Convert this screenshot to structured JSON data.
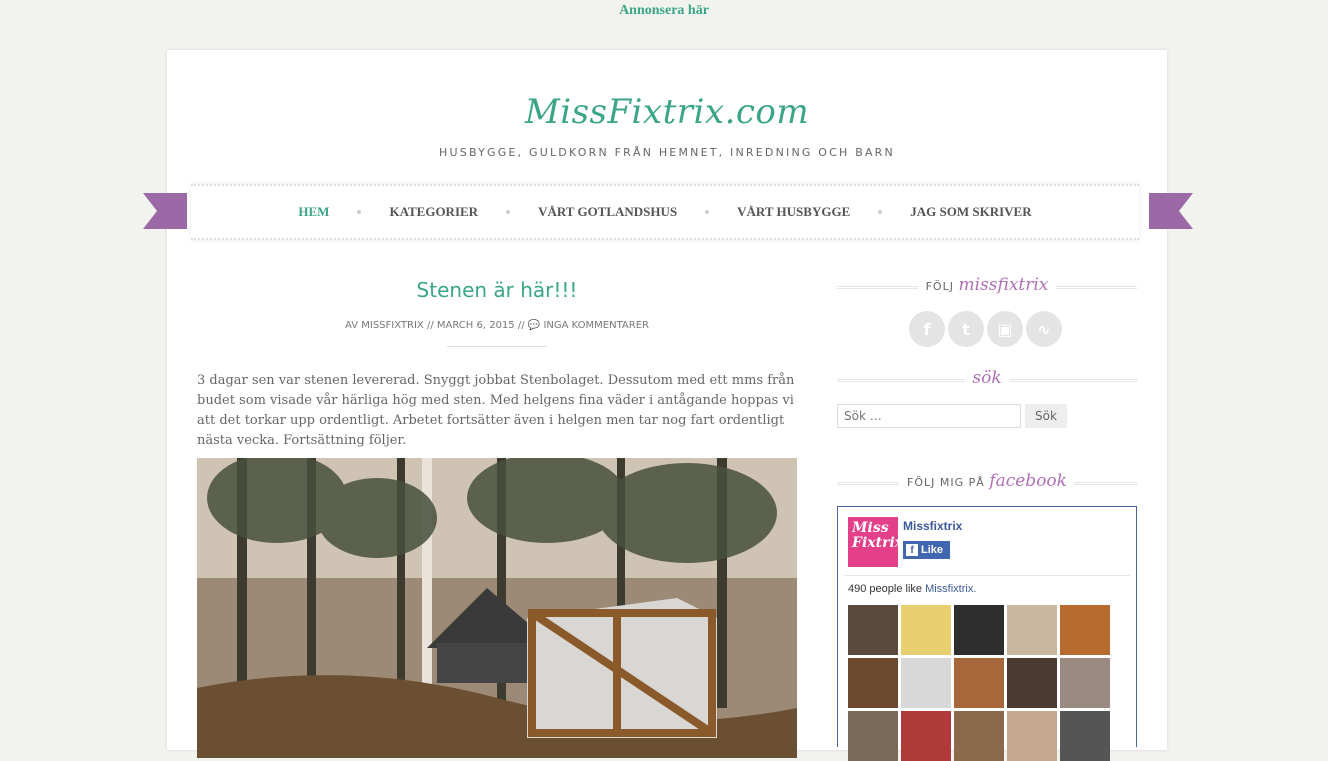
{
  "topbar": {
    "link": "Annonsera här"
  },
  "header": {
    "logo": "MissFixtrix.com",
    "tagline": "HUSBYGGE, GULDKORN FRÅN HEMNET, INREDNING OCH BARN"
  },
  "nav": {
    "items": [
      {
        "label": "HEM"
      },
      {
        "label": "KATEGORIER"
      },
      {
        "label": "VÅRT GOTLANDSHUS"
      },
      {
        "label": "VÅRT HUSBYGGE"
      },
      {
        "label": "JAG SOM SKRIVER"
      }
    ]
  },
  "post": {
    "title": "Stenen är här!!!",
    "meta": {
      "prefix": "AV",
      "author": "MISSFIXTRIX",
      "sep": "//",
      "date": "MARCH 6, 2015",
      "comments": "INGA KOMMENTARER"
    },
    "body": "3 dagar sen var stenen levererad. Snyggt jobbat Stenbolaget. Dessutom med ett mms från budet som visade vår härliga hög med sten. Med helgens fina väder i antågande hoppas vi att det torkar upp ordentligt. Arbetet fortsätter även i helgen men tar nog fart ordentligt nästa vecka. Fortsättning följer."
  },
  "sidebar": {
    "follow": {
      "label": "FÖLJ",
      "script": "missfixtrix",
      "icons": [
        "facebook-icon",
        "twitter-icon",
        "instagram-icon",
        "rss-icon"
      ]
    },
    "search": {
      "title": "sök",
      "placeholder": "Sök …",
      "button": "Sök"
    },
    "facebook": {
      "label": "FÖLJ MIG PÅ",
      "script": "facebook",
      "page_name": "Missfixtrix",
      "like": "Like",
      "count_text": "490 people like",
      "count_link": "Missfixtrix.",
      "avatar_text": "Miss Fixtrix"
    }
  },
  "colors": {
    "accent": "#3aa587",
    "ribbon": "#9b6aa6",
    "script": "#b06fb6",
    "fb": "#3b5998"
  }
}
